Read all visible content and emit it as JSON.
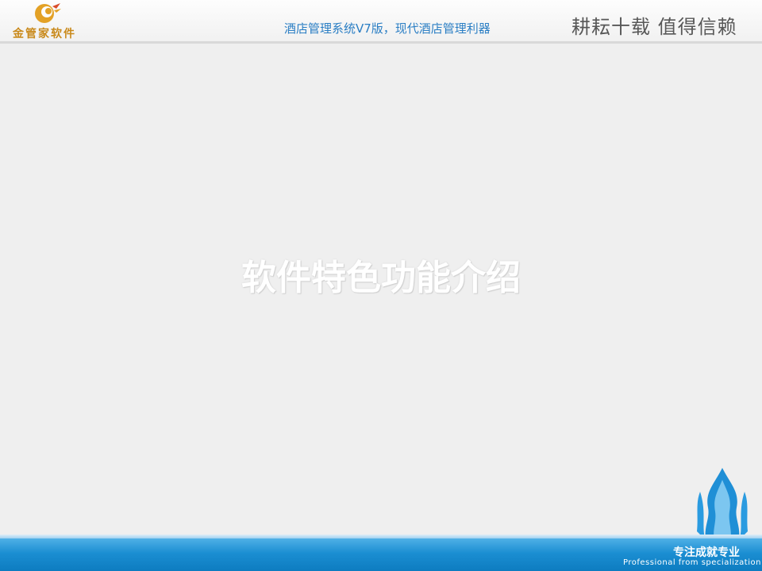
{
  "header": {
    "logo_text": "金管家软件",
    "tagline": "酒店管理系统V7版，现代酒店管理利器",
    "slogan": "耕耘十载  值得信赖"
  },
  "slide": {
    "title": "软件特色功能介绍"
  },
  "footer": {
    "slogan_cn": "专注成就专业",
    "slogan_en": "Professional from specialization"
  },
  "colors": {
    "background": "#efefef",
    "tagline": "#2a7ec4",
    "footer_bar": "#1b8ed2",
    "logo": "#c9891a"
  }
}
